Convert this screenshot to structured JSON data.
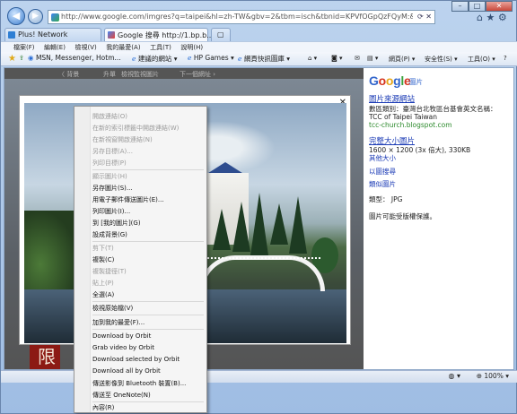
{
  "browser": {
    "address": "http://www.google.com/imgres?q=taipei&hl=zh-TW&gbv=2&tbm=isch&tbnid=KPVfOGpQzFQyM:&imgrefurl=http://tcc-church.blo",
    "tabs": [
      {
        "label": "Plus! Network"
      },
      {
        "label": "Google 搜尋 http://1.bp.b..."
      }
    ],
    "menu": [
      "檔案(F)",
      "編輯(E)",
      "檢視(V)",
      "我的最愛(A)",
      "工具(T)",
      "說明(H)"
    ],
    "favorites": [
      {
        "label": "MSN, Messenger, Hotm..."
      },
      {
        "label": "建議的網站 ▾"
      },
      {
        "label": "HP Games ▾"
      },
      {
        "label": "網頁快訊圖庫 ▾"
      }
    ],
    "tools": [
      "網頁(P) ▾",
      "安全性(S) ▾",
      "工具(O) ▾"
    ],
    "zoom": "100%"
  },
  "google_bar": {
    "items": [
      "〈 背景",
      "升單",
      "檢視監視圖片",
      "下一個網址 ›"
    ]
  },
  "lightbox": {
    "close": "✕"
  },
  "right_pane": {
    "logo_parts": [
      "G",
      "o",
      "o",
      "g",
      "l",
      "e"
    ],
    "logo_sub": "圖片",
    "source_link": "圖片來源網站",
    "source_desc": "數區類別：臺灣台北牧區台基會英文名稱：",
    "source_name": "TCC of Taipei Taiwan",
    "source_url": "tcc-church.blogspot.com",
    "full_link": "完整大小圖片",
    "dims": "1600 × 1200 (3x 倍大), 330KB",
    "other_sizes": "其他大小",
    "search_by_image": "以圖搜尋",
    "similar": "類似圖片",
    "type": "類型：  JPG",
    "copyright": "圖片可能受版權保護。"
  },
  "background": {
    "red_char": "限"
  },
  "context_menu": {
    "items": [
      {
        "label": "開啟連結(O)",
        "disabled": true
      },
      {
        "label": "在新的索引標籤中開啟連結(W)",
        "disabled": true
      },
      {
        "label": "在新視窗開啟連結(N)",
        "disabled": true
      },
      {
        "label": "另存目標(A)...",
        "disabled": true
      },
      {
        "label": "列印目標(P)",
        "disabled": true
      },
      {
        "label": "顯示圖片(H)",
        "disabled": true
      },
      {
        "label": "另存圖片(S)...",
        "disabled": false
      },
      {
        "label": "用電子郵件傳送圖片(E)...",
        "disabled": false
      },
      {
        "label": "列印圖片(I)...",
        "disabled": false
      },
      {
        "label": "到 [我的圖片](G)",
        "disabled": false
      },
      {
        "label": "設成背景(G)",
        "disabled": false
      },
      {
        "label": "剪下(T)",
        "disabled": true
      },
      {
        "label": "複製(C)",
        "disabled": false
      },
      {
        "label": "複製捷徑(T)",
        "disabled": true
      },
      {
        "label": "貼上(P)",
        "disabled": true
      },
      {
        "label": "全選(A)",
        "disabled": false
      },
      {
        "label": "檢視原始檔(V)",
        "disabled": false
      },
      {
        "label": "加到我的最愛(F)...",
        "disabled": false
      },
      {
        "label": "Download by Orbit",
        "disabled": false
      },
      {
        "label": "Grab video by Orbit",
        "disabled": false
      },
      {
        "label": "Download selected by Orbit",
        "disabled": false
      },
      {
        "label": "Download all by Orbit",
        "disabled": false
      },
      {
        "label": "傳送影像到 Bluetooth 裝置(B)...",
        "disabled": false
      },
      {
        "label": "傳送至 OneNote(N)",
        "disabled": false
      },
      {
        "label": "內容(R)",
        "disabled": false
      }
    ]
  }
}
